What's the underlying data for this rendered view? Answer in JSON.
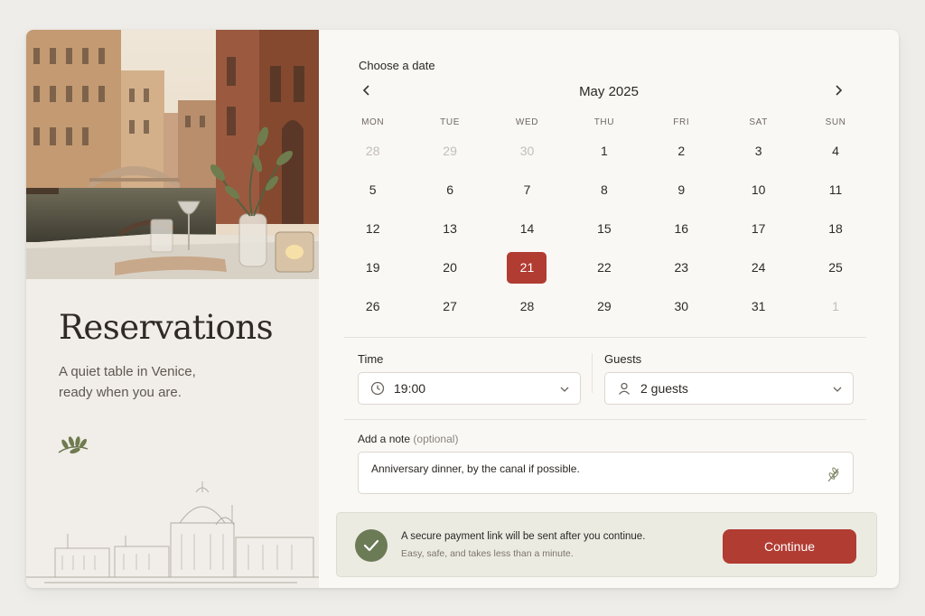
{
  "left": {
    "title": "Reservations",
    "tagline": [
      "A quiet table in Venice,",
      "ready when you are."
    ]
  },
  "calendar": {
    "label": "Choose a date",
    "month": "May 2025",
    "prev_icon": "chevron-left-icon",
    "next_icon": "chevron-right-icon",
    "weekdays": [
      "MON",
      "TUE",
      "WED",
      "THU",
      "FRI",
      "SAT",
      "SUN"
    ],
    "weeks": [
      [
        "28",
        "29",
        "30",
        "1",
        "2",
        "3",
        "4"
      ],
      [
        "5",
        "6",
        "7",
        "8",
        "9",
        "10",
        "11"
      ],
      [
        "12",
        "13",
        "14",
        "15",
        "16",
        "17",
        "18"
      ],
      [
        "19",
        "20",
        "21",
        "22",
        "23",
        "24",
        "25"
      ],
      [
        "26",
        "27",
        "28",
        "29",
        "30",
        "31",
        "1"
      ]
    ],
    "selected": "21",
    "selected_color": "#b13c32"
  },
  "time": {
    "label": "Time",
    "value": "19:00",
    "icon": "clock-icon"
  },
  "guests": {
    "label": "Guests",
    "value": "2 guests",
    "icon": "person-icon"
  },
  "note": {
    "label": "Add a note",
    "optional": "(optional)",
    "value": "Anniversary dinner, by the canal if possible.",
    "icon": "leaf-icon"
  },
  "footer": {
    "message": "A secure payment link will be sent after you continue.",
    "sub": "Easy, safe, and takes less than a minute.",
    "button": "Continue",
    "accent": "#b13c32",
    "check_color": "#6b7b56"
  }
}
